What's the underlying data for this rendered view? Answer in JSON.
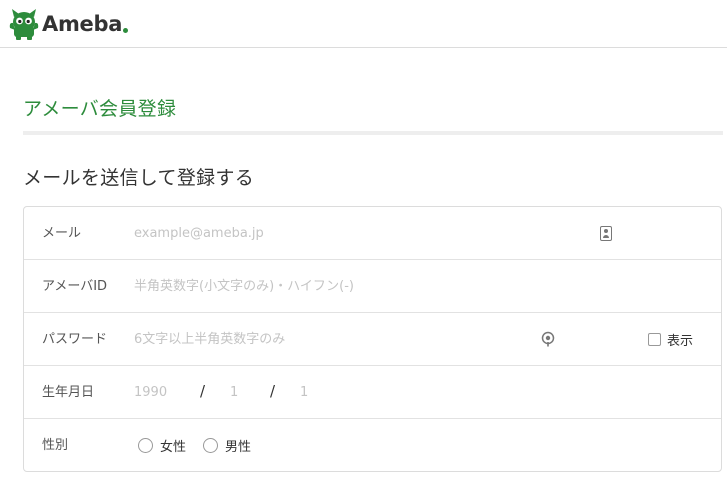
{
  "header": {
    "logo_text": "Ameba",
    "logo_color": "#2d8c3c"
  },
  "page": {
    "title": "アメーバ会員登録",
    "section_title": "メールを送信して登録する"
  },
  "form": {
    "email": {
      "label": "メール",
      "placeholder": "example@ameba.jp",
      "icon": "contact-card-icon"
    },
    "ameba_id": {
      "label": "アメーバID",
      "placeholder": "半角英数字(小文字のみ)・ハイフン(-)"
    },
    "password": {
      "label": "パスワード",
      "placeholder": "6文字以上半角英数字のみ",
      "icon": "eye-icon",
      "show_label": "表示"
    },
    "birthday": {
      "label": "生年月日",
      "year_placeholder": "1990",
      "month_placeholder": "1",
      "day_placeholder": "1",
      "separator": "/"
    },
    "gender": {
      "label": "性別",
      "options": [
        "女性",
        "男性"
      ]
    }
  }
}
